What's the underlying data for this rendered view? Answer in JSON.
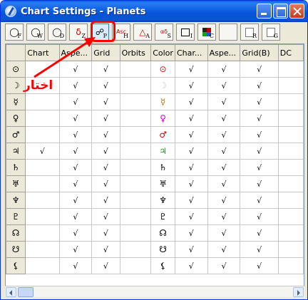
{
  "window": {
    "title": "Chart Settings - Planets"
  },
  "toolbar": {
    "buttons": [
      {
        "icon": "circle-F-icon",
        "symbol": "◯",
        "letter": "F"
      },
      {
        "icon": "circle-W-icon",
        "symbol": "◯",
        "letter": "W"
      },
      {
        "icon": "circle-D-icon",
        "symbol": "◯",
        "letter": "D"
      },
      {
        "icon": "circle-Z-icon",
        "symbol": "δ",
        "letter": "Z"
      },
      {
        "icon": "aspect-P-icon",
        "symbol": "☍",
        "letter": "P"
      },
      {
        "icon": "asc-H-icon",
        "symbol": "Asc",
        "letter": "H"
      },
      {
        "icon": "triangle-A-icon",
        "symbol": "△",
        "letter": "A"
      },
      {
        "icon": "alpha-S-icon",
        "symbol": "αδ",
        "letter": "S"
      },
      {
        "icon": "box-I-icon",
        "symbol": "",
        "letter": "I"
      },
      {
        "icon": "color-grid-C-icon",
        "symbol": "",
        "letter": "C"
      },
      {
        "icon": "font-T-icon",
        "symbol": "T",
        "letter": ""
      },
      {
        "icon": "page-R-icon",
        "symbol": "",
        "letter": "R"
      },
      {
        "icon": "page-G-icon",
        "symbol": "",
        "letter": "G"
      }
    ]
  },
  "table": {
    "columns": [
      "",
      "Chart",
      "Aspe...",
      "Grid",
      "Orbits",
      "Color",
      "Char...",
      "Aspe...",
      "Grid(B)",
      "DC"
    ],
    "check_mark": "√",
    "rows": [
      {
        "symbol": "⊙",
        "color_symbol": "⊙",
        "color": "#e00000",
        "chart": "",
        "aspects": "√",
        "grid": "√",
        "orbits": "",
        "char": "√",
        "aspe2": "√",
        "gridb": "√",
        "dc": ""
      },
      {
        "symbol": "☽",
        "color_symbol": "☽",
        "color": "#c8c8c8",
        "chart": "",
        "aspects": "√",
        "grid": "√",
        "orbits": "",
        "char": "√",
        "aspe2": "√",
        "gridb": "√",
        "dc": ""
      },
      {
        "symbol": "☿",
        "color_symbol": "☿",
        "color": "#9a7a30",
        "chart": "",
        "aspects": "√",
        "grid": "√",
        "orbits": "",
        "char": "√",
        "aspe2": "√",
        "gridb": "√",
        "dc": ""
      },
      {
        "symbol": "♀",
        "color_symbol": "♀",
        "color": "#d000d0",
        "chart": "",
        "aspects": "√",
        "grid": "√",
        "orbits": "",
        "char": "√",
        "aspe2": "√",
        "gridb": "√",
        "dc": ""
      },
      {
        "symbol": "♂",
        "color_symbol": "♂",
        "color": "#c00000",
        "chart": "",
        "aspects": "√",
        "grid": "√",
        "orbits": "",
        "char": "√",
        "aspe2": "√",
        "gridb": "√",
        "dc": ""
      },
      {
        "symbol": "♃",
        "color_symbol": "♃",
        "color": "#10a010",
        "chart": "√",
        "aspects": "√",
        "grid": "√",
        "orbits": "",
        "char": "√",
        "aspe2": "√",
        "gridb": "√",
        "dc": ""
      },
      {
        "symbol": "♄",
        "color_symbol": "♄",
        "color": "#000000",
        "chart": "",
        "aspects": "√",
        "grid": "√",
        "orbits": "",
        "char": "√",
        "aspe2": "√",
        "gridb": "√",
        "dc": ""
      },
      {
        "symbol": "♅",
        "color_symbol": "♅",
        "color": "#000000",
        "chart": "",
        "aspects": "√",
        "grid": "√",
        "orbits": "",
        "char": "√",
        "aspe2": "√",
        "gridb": "√",
        "dc": ""
      },
      {
        "symbol": "♆",
        "color_symbol": "♆",
        "color": "#000000",
        "chart": "",
        "aspects": "√",
        "grid": "√",
        "orbits": "",
        "char": "√",
        "aspe2": "√",
        "gridb": "√",
        "dc": ""
      },
      {
        "symbol": "♇",
        "color_symbol": "♇",
        "color": "#000000",
        "chart": "",
        "aspects": "√",
        "grid": "√",
        "orbits": "",
        "char": "√",
        "aspe2": "√",
        "gridb": "√",
        "dc": ""
      },
      {
        "symbol": "☊",
        "color_symbol": "☊",
        "color": "#000000",
        "chart": "",
        "aspects": "√",
        "grid": "√",
        "orbits": "",
        "char": "√",
        "aspe2": "√",
        "gridb": "√",
        "dc": ""
      },
      {
        "symbol": "☋",
        "color_symbol": "☋",
        "color": "#000000",
        "chart": "",
        "aspects": "√",
        "grid": "√",
        "orbits": "",
        "char": "√",
        "aspe2": "√",
        "gridb": "√",
        "dc": ""
      },
      {
        "symbol": "⚸",
        "color_symbol": "⚸",
        "color": "#000000",
        "chart": "",
        "aspects": "√",
        "grid": "√",
        "orbits": "",
        "char": "√",
        "aspe2": "√",
        "gridb": "√",
        "dc": ""
      }
    ]
  },
  "annotation": {
    "label": "اختار",
    "color": "#ff0000"
  }
}
